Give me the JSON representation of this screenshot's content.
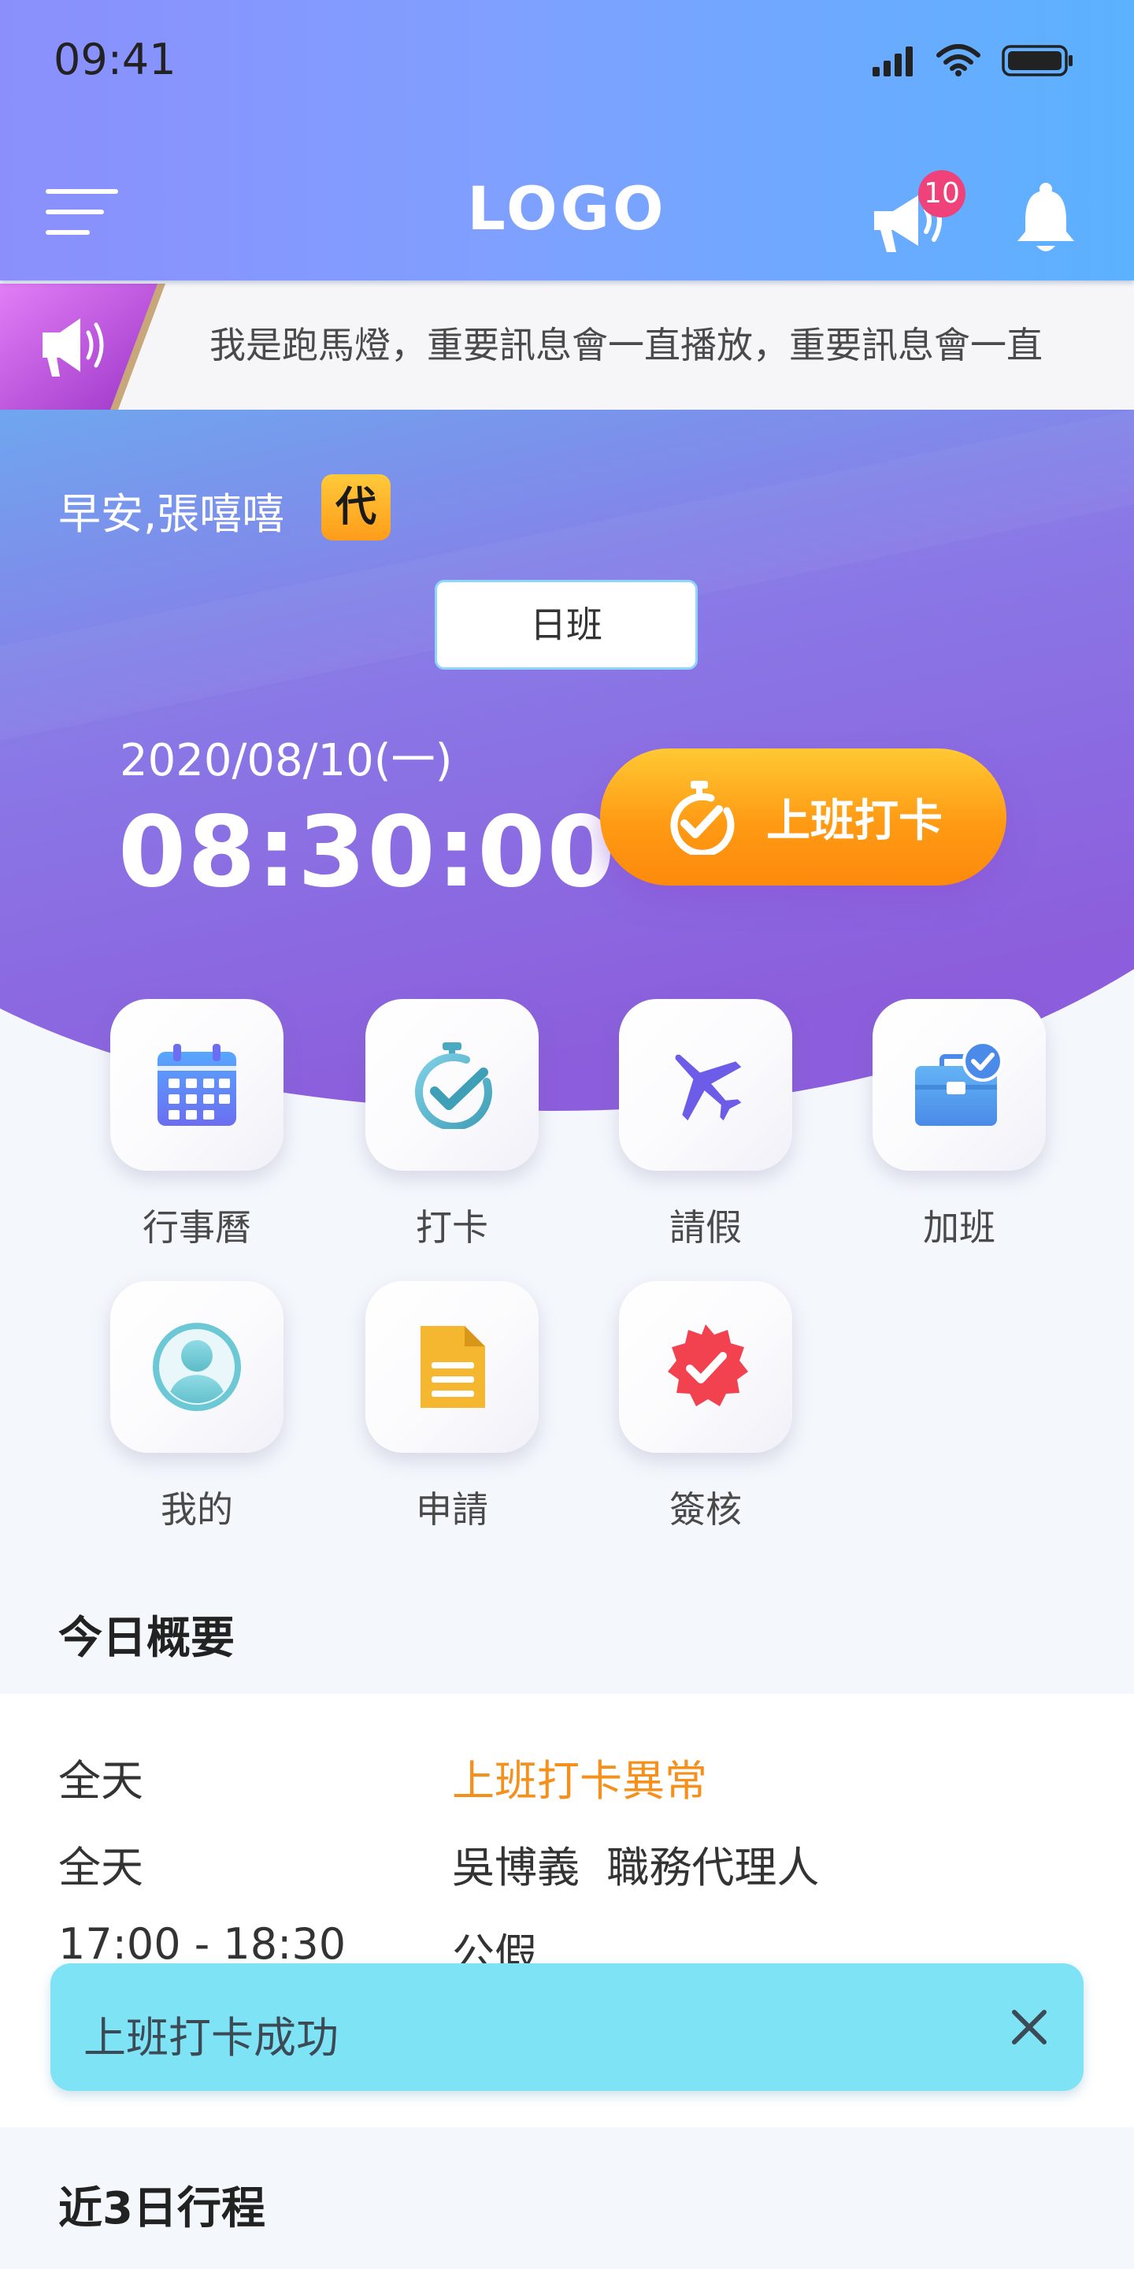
{
  "status_bar": {
    "time": "09:41"
  },
  "header": {
    "logo": "LOGO",
    "announcement_badge": "10"
  },
  "marquee": {
    "text": "我是跑馬燈，重要訊息會一直播放，重要訊息會一直"
  },
  "hero": {
    "greeting": "早安,張嘻嘻",
    "agent_badge": "代",
    "shift": "日班",
    "date": "2020/08/10(一)",
    "time": "08:30:00",
    "punch_label": "上班打卡"
  },
  "features": [
    {
      "label": "行事曆",
      "icon": "calendar-icon"
    },
    {
      "label": "打卡",
      "icon": "stopwatch-check-icon"
    },
    {
      "label": "請假",
      "icon": "airplane-icon"
    },
    {
      "label": "加班",
      "icon": "briefcase-check-icon"
    },
    {
      "label": "我的",
      "icon": "user-avatar-icon"
    },
    {
      "label": "申請",
      "icon": "document-icon"
    },
    {
      "label": "簽核",
      "icon": "badge-check-icon"
    }
  ],
  "summary": {
    "title": "今日概要",
    "rows": [
      {
        "when": "全天",
        "what": "上班打卡異常"
      },
      {
        "when": "全天",
        "what": "吳博義  職務代理人"
      },
      {
        "when": "17:00 - 18:30",
        "what": "公假"
      }
    ]
  },
  "upcoming": {
    "title": "近3日行程"
  },
  "toast": {
    "text": "上班打卡成功"
  },
  "colors": {
    "accent_orange": "#f5901c",
    "hero_purple": "#8d5fdc",
    "header_blue": "#5bb2ff",
    "toast_cyan": "#7fe3f6",
    "badge_pink": "#f0427a"
  }
}
